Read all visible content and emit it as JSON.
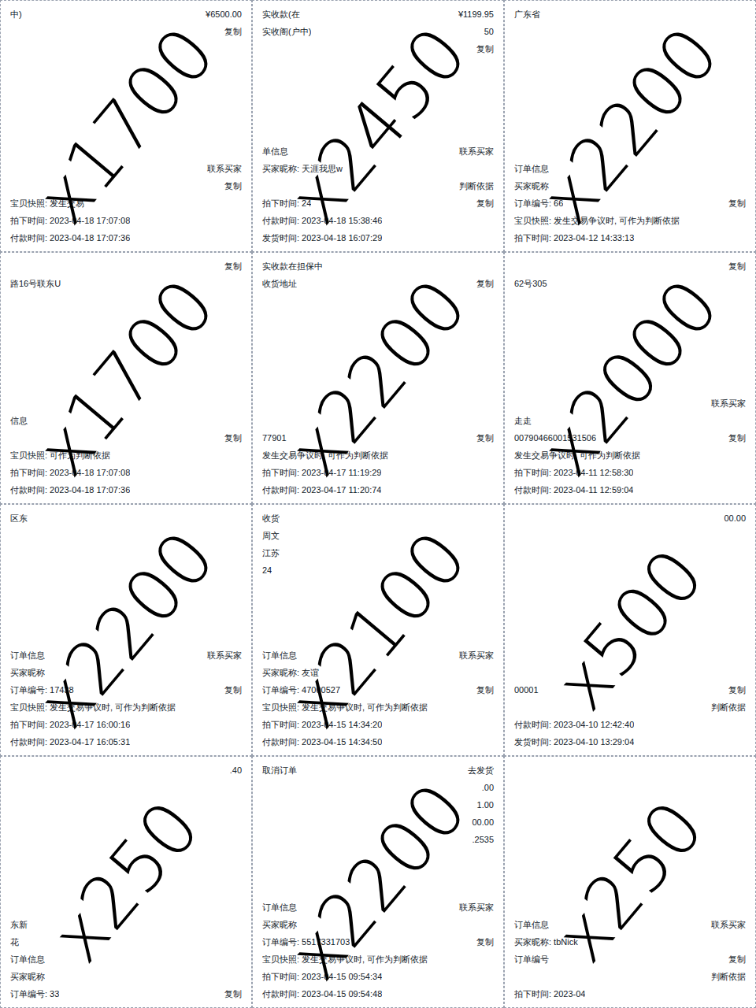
{
  "tiles": [
    {
      "annotation": "x1700",
      "top": [
        {
          "left": "中)",
          "right": "¥6500.00"
        },
        {
          "left": "",
          "right": "复制"
        }
      ],
      "bottom": [
        {
          "left": "",
          "right": "联系买家"
        },
        {
          "left": "",
          "right": "复制"
        },
        {
          "left": "宝贝快照: 发生交易",
          "right": ""
        },
        {
          "left": "拍下时间: 2023-04-18 17:07:08",
          "right": ""
        },
        {
          "left": "付款时间: 2023-04-18 17:07:36",
          "right": ""
        }
      ]
    },
    {
      "annotation": "x2450",
      "top": [
        {
          "left": "实收款(在",
          "right": "¥1199.95"
        },
        {
          "left": "实收阁(户中)",
          "right": "50"
        },
        {
          "left": "",
          "right": "复制"
        }
      ],
      "bottom": [
        {
          "left": "单信息",
          "right": "联系买家"
        },
        {
          "left": "买家昵称: 天涯我思w",
          "right": ""
        },
        {
          "left": "",
          "right": "判断依据"
        },
        {
          "left": "拍下时间: 24",
          "right": "复制"
        },
        {
          "left": "付款时间: 2023-04-18 15:38:46",
          "right": ""
        },
        {
          "left": "发货时间: 2023-04-18 16:07:29",
          "right": ""
        }
      ]
    },
    {
      "annotation": "x2200",
      "top": [
        {
          "left": "广东省",
          "right": ""
        }
      ],
      "bottom": [
        {
          "left": "订单信息",
          "right": ""
        },
        {
          "left": "买家昵称",
          "right": ""
        },
        {
          "left": "订单编号: 66",
          "right": "复制"
        },
        {
          "left": "宝贝快照: 发生交易争议时, 可作为判断依据",
          "right": ""
        },
        {
          "left": "拍下时间: 2023-04-12 14:33:13",
          "right": ""
        }
      ]
    },
    {
      "annotation": "x1700",
      "top": [
        {
          "left": "",
          "right": "复制"
        },
        {
          "left": "路16号联东U",
          "right": ""
        }
      ],
      "bottom": [
        {
          "left": "信息",
          "right": ""
        },
        {
          "left": "",
          "right": "复制"
        },
        {
          "left": "宝贝快照: 可作为判断依据",
          "right": ""
        },
        {
          "left": "拍下时间: 2023-04-18 17:07:08",
          "right": ""
        },
        {
          "left": "付款时间: 2023-04-18 17:07:36",
          "right": ""
        }
      ]
    },
    {
      "annotation": "x2200",
      "top": [
        {
          "left": "实收款在担保中",
          "right": ""
        },
        {
          "left": "收货地址",
          "right": "复制"
        }
      ],
      "bottom": [
        {
          "left": "77901",
          "right": "复制"
        },
        {
          "left": "发生交易争议时, 可作为判断依据",
          "right": ""
        },
        {
          "left": "拍下时间: 2023-04-17 11:19:29",
          "right": ""
        },
        {
          "left": "付款时间: 2023-04-17 11:20:74",
          "right": ""
        }
      ]
    },
    {
      "annotation": "x2000",
      "top": [
        {
          "left": "",
          "right": "复制"
        },
        {
          "left": "62号305",
          "right": ""
        }
      ],
      "bottom": [
        {
          "left": "",
          "right": "联系买家"
        },
        {
          "left": "走走",
          "right": ""
        },
        {
          "left": "00790466001531506",
          "right": "复制"
        },
        {
          "left": "发生交易争议时, 可作为判断依据",
          "right": ""
        },
        {
          "left": "拍下时间: 2023-04-11 12:58:30",
          "right": ""
        },
        {
          "left": "付款时间: 2023-04-11 12:59:04",
          "right": ""
        }
      ]
    },
    {
      "annotation": "x2200",
      "top": [
        {
          "left": "区东",
          "right": ""
        }
      ],
      "bottom": [
        {
          "left": "订单信息",
          "right": "联系买家"
        },
        {
          "left": "买家昵称",
          "right": ""
        },
        {
          "left": "订单编号: 17438",
          "right": "复制"
        },
        {
          "left": "宝贝快照: 发生交易争议时, 可作为判断依据",
          "right": ""
        },
        {
          "left": "拍下时间: 2023-04-17 16:00:16",
          "right": ""
        },
        {
          "left": "付款时间: 2023-04-17 16:05:31",
          "right": ""
        }
      ]
    },
    {
      "annotation": "x2100",
      "top": [
        {
          "left": "收货",
          "right": ""
        },
        {
          "left": "周文",
          "right": ""
        },
        {
          "left": "江苏",
          "right": ""
        },
        {
          "left": "24",
          "right": ""
        }
      ],
      "bottom": [
        {
          "left": "订单信息",
          "right": "联系买家"
        },
        {
          "left": "买家昵称: 友谊",
          "right": ""
        },
        {
          "left": "订单编号: 47000527",
          "right": "复制"
        },
        {
          "left": "宝贝快照: 发生交易争议时, 可作为判断依据",
          "right": ""
        },
        {
          "left": "拍下时间: 2023-04-15 14:34:20",
          "right": ""
        },
        {
          "left": "付款时间: 2023-04-15 14:34:50",
          "right": ""
        }
      ]
    },
    {
      "annotation": "x500",
      "top": [
        {
          "left": "",
          "right": "00.00"
        }
      ],
      "bottom": [
        {
          "left": "00001",
          "right": "复制"
        },
        {
          "left": "",
          "right": "判断依据"
        },
        {
          "left": "付款时间: 2023-04-10 12:42:40",
          "right": ""
        },
        {
          "left": "发货时间: 2023-04-10 13:29:04",
          "right": ""
        }
      ]
    },
    {
      "annotation": "x250",
      "top": [
        {
          "left": "",
          "right": ".40"
        }
      ],
      "bottom": [
        {
          "left": "东新",
          "right": ""
        },
        {
          "left": "花",
          "right": ""
        },
        {
          "left": "订单信息",
          "right": ""
        },
        {
          "left": "买家昵称",
          "right": ""
        },
        {
          "left": "订单编号: 33",
          "right": "复制"
        }
      ]
    },
    {
      "annotation": "x2200",
      "top": [
        {
          "left": "取消订单",
          "right": "去发货"
        },
        {
          "left": "",
          "right": ".00"
        },
        {
          "left": "",
          "right": "1.00"
        },
        {
          "left": "",
          "right": "00.00"
        },
        {
          "left": "",
          "right": ".2535"
        }
      ],
      "bottom": [
        {
          "left": "订单信息",
          "right": "联系买家"
        },
        {
          "left": "买家昵称",
          "right": ""
        },
        {
          "left": "订单编号: 5517331703",
          "right": "复制"
        },
        {
          "left": "宝贝快照: 发生交易争议时, 可作为判断依据",
          "right": ""
        },
        {
          "left": "拍下时间: 2023-04-15 09:54:34",
          "right": ""
        },
        {
          "left": "付款时间: 2023-04-15 09:54:48",
          "right": ""
        }
      ]
    },
    {
      "annotation": "x250",
      "top": [],
      "bottom": [
        {
          "left": "订单信息",
          "right": "联系买家"
        },
        {
          "left": "买家昵称: tbNick",
          "right": ""
        },
        {
          "left": "订单编号",
          "right": "复制"
        },
        {
          "left": "",
          "right": "判断依据"
        },
        {
          "left": "拍下时间: 2023-04",
          "right": ""
        }
      ]
    }
  ]
}
